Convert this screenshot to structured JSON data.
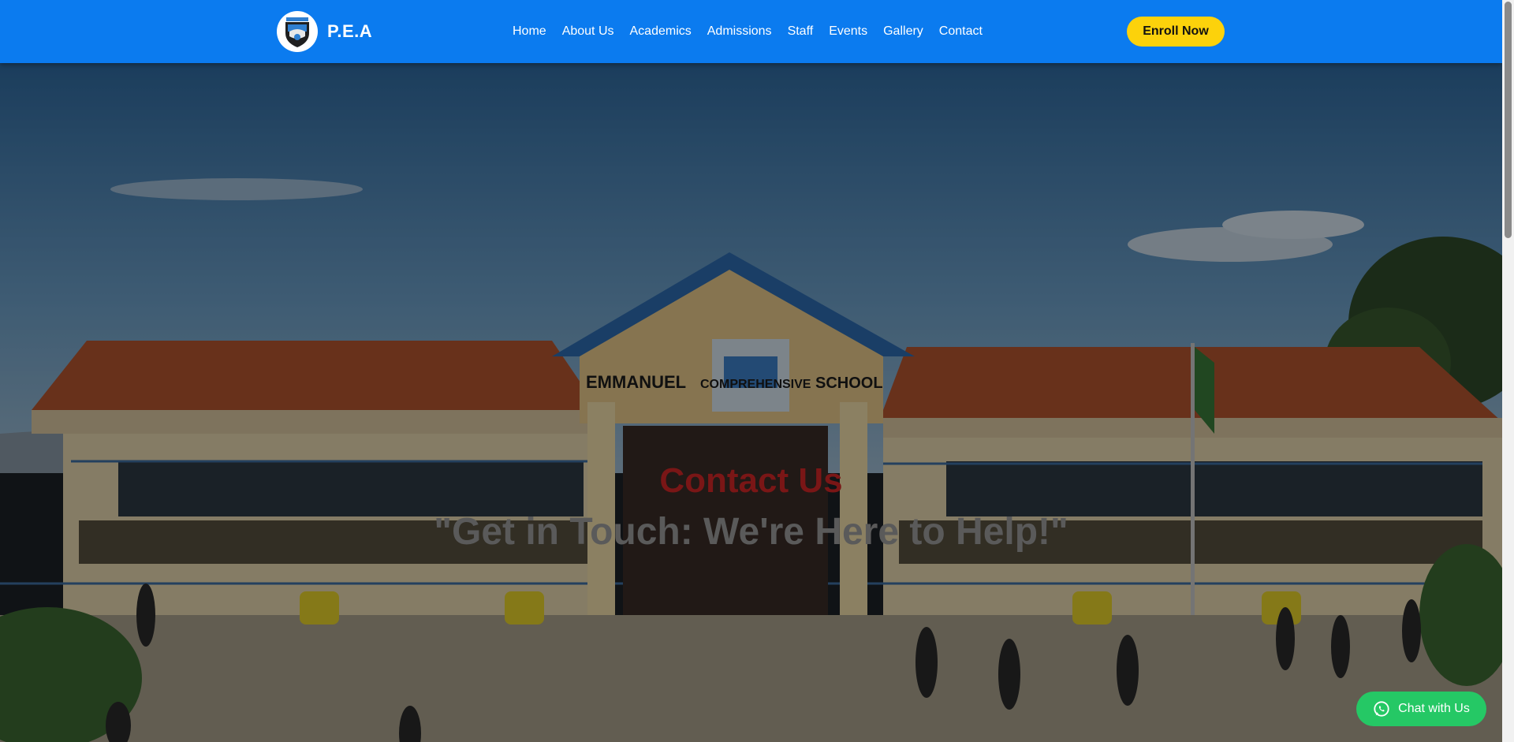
{
  "header": {
    "brand": "P.E.A",
    "nav": [
      "Home",
      "About Us",
      "Academics",
      "Admissions",
      "Staff",
      "Events",
      "Gallery",
      "Contact"
    ],
    "cta": "Enroll Now"
  },
  "hero": {
    "school_sign_left": "EMMANUEL",
    "school_sign_middle": "COMPREHENSIVE",
    "school_sign_right": "SCHOOL",
    "title": "Contact Us",
    "subtitle": "\"Get in Touch: We're Here to Help!\""
  },
  "chat": {
    "label": "Chat with Us"
  },
  "icons": {
    "logo": "school-crest-icon",
    "chat": "whatsapp-icon"
  },
  "colors": {
    "header_bg": "#0b7bef",
    "cta_bg": "#fcd20b",
    "chat_bg": "#25c865",
    "title": "#7a1616"
  }
}
